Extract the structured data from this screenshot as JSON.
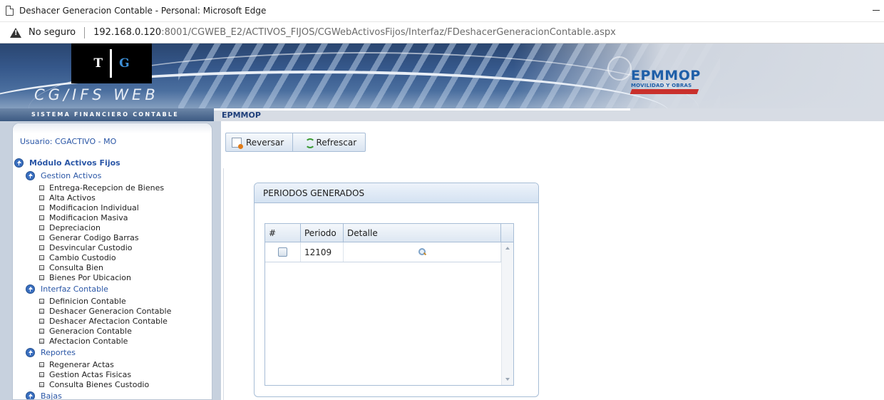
{
  "browser": {
    "window_title": "Deshacer Generacion Contable - Personal: Microsoft Edge",
    "security_label": "No seguro",
    "url_host": "192.168.0.120",
    "url_rest": ":8001/CGWEB_E2/ACTIVOS_FIJOS/CGWebActivosFijos/Interfaz/FDeshacerGeneracionContable.aspx"
  },
  "header": {
    "logo_t": "T",
    "logo_g": "G",
    "app_name": "CG/IFS WEB",
    "app_subtitle": "SISTEMA FINANCIERO CONTABLE",
    "org_logo_name": "EPMMOP",
    "org_logo_sub": "MOVILIDAD Y OBRAS",
    "org_label": "EPMMOP"
  },
  "sidebar": {
    "user": "Usuario: CGACTIVO - MO",
    "module": "Módulo Activos Fijos",
    "groups": [
      {
        "label": "Gestion Activos",
        "items": [
          "Entrega-Recepcion de Bienes",
          "Alta Activos",
          "Modificacion Individual",
          "Modificacion Masiva",
          "Depreciacion",
          "Generar Codigo Barras",
          "Desvincular Custodio",
          "Cambio Custodio",
          "Consulta Bien",
          "Bienes Por Ubicacion"
        ]
      },
      {
        "label": "Interfaz Contable",
        "items": [
          "Definicion Contable",
          "Deshacer Generacion Contable",
          "Deshacer Afectacion Contable",
          "Generacion Contable",
          "Afectacion Contable"
        ]
      },
      {
        "label": "Reportes",
        "items": [
          "Regenerar Actas",
          "Gestion Actas Fisicas",
          "Consulta Bienes Custodio"
        ]
      },
      {
        "label": "Bajas",
        "items": []
      }
    ]
  },
  "toolbar": {
    "reversar": "Reversar",
    "refrescar": "Refrescar"
  },
  "periods": {
    "title": "PERIODOS GENERADOS",
    "columns": [
      "#",
      "Periodo",
      "Detalle"
    ],
    "rows": [
      {
        "checked": false,
        "periodo": "12109"
      }
    ]
  },
  "colors": {
    "accent": "#2a56a6",
    "banner": "#35578a",
    "brand_red": "#c9302c"
  }
}
